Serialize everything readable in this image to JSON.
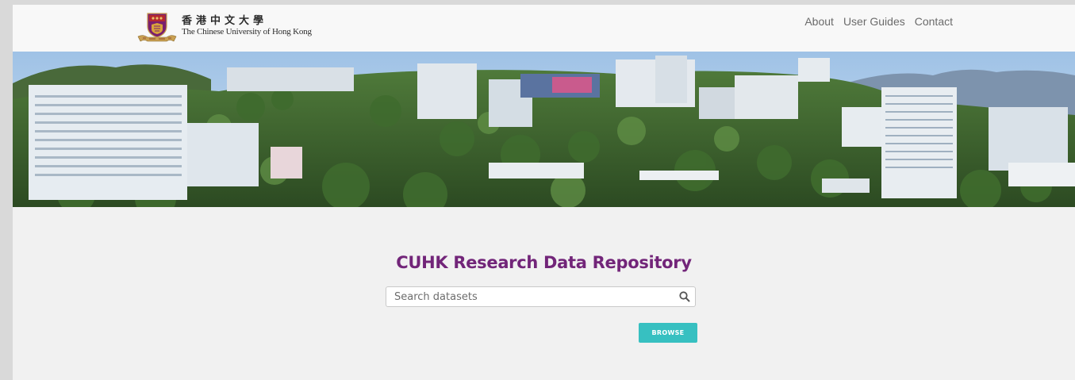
{
  "header": {
    "logo": {
      "name_zh": "香港中文大學",
      "name_en": "The Chinese University of Hong Kong"
    },
    "nav": [
      {
        "label": "About"
      },
      {
        "label": "User Guides"
      },
      {
        "label": "Contact"
      }
    ]
  },
  "hero": {
    "image": "campus-panorama"
  },
  "main": {
    "title": "CUHK Research Data Repository",
    "search": {
      "placeholder": "Search datasets",
      "value": "",
      "icon": "search-icon"
    },
    "browse_label": "BROWSE"
  },
  "colors": {
    "title": "#722579",
    "browse_button": "#37c0c1",
    "navbar": "#f8f8f8",
    "page_background": "#f1f1f1",
    "nav_link": "#6b6b6b"
  }
}
